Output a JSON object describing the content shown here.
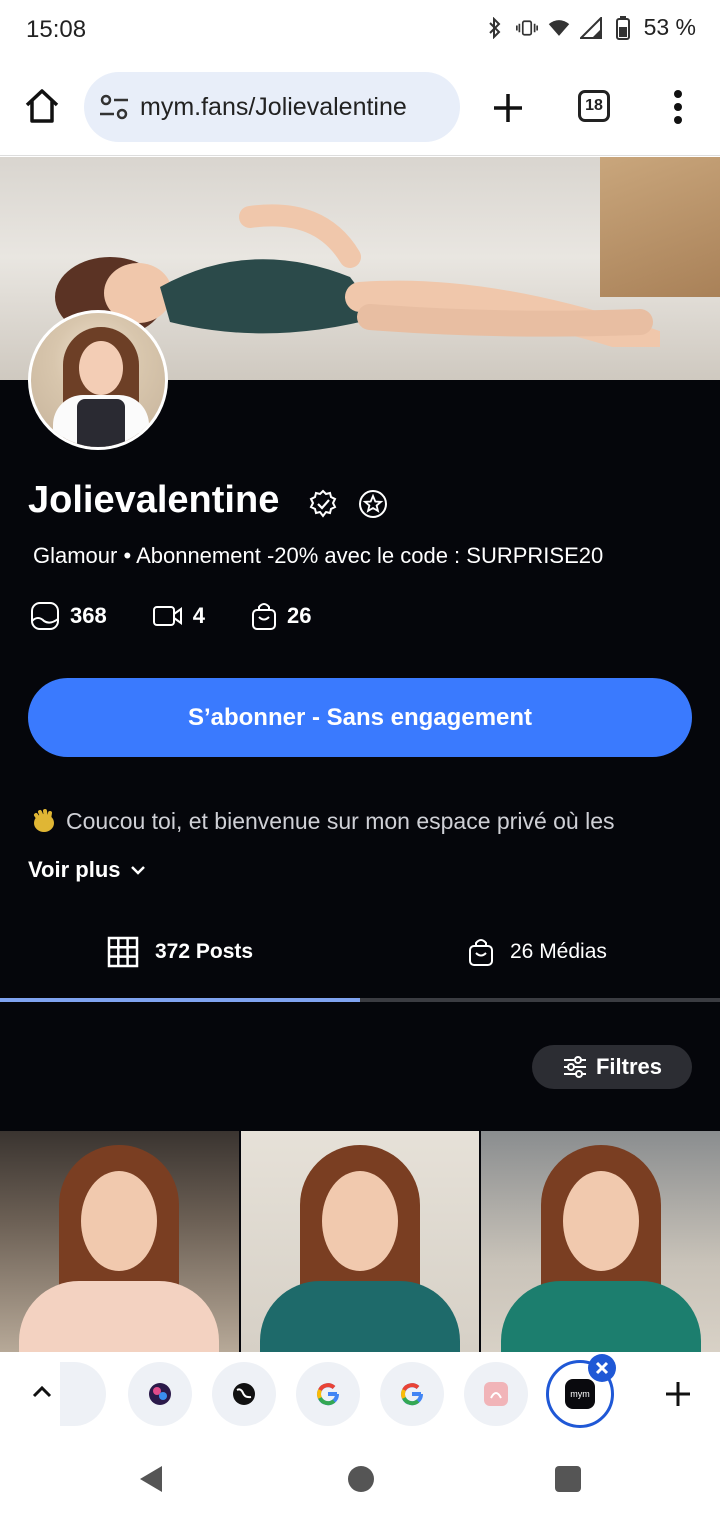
{
  "status_bar": {
    "time": "15:08",
    "battery": "53 %"
  },
  "browser": {
    "url": "mym.fans/Jolievalentine",
    "tab_count": "18"
  },
  "profile": {
    "name": "Jolievalentine",
    "description": "Glamour • Abonnement -20% avec le code : SURPRISE20",
    "stats": [
      {
        "icon": "image-icon",
        "value": "368"
      },
      {
        "icon": "video-icon",
        "value": "4"
      },
      {
        "icon": "shopping-bag-icon",
        "value": "26"
      }
    ],
    "subscribe_label": "S’abonner - Sans engagement",
    "bio": "Coucou toi, et bienvenue sur mon espace privé où les",
    "see_more": "Voir plus"
  },
  "tabs": {
    "posts": "372 Posts",
    "medias": "26 Médias"
  },
  "filter_label": "Filtres",
  "tab_switcher": {
    "active_tab_label": "mym"
  },
  "colors": {
    "accent": "#3a7afe",
    "page_bg": "#05060b",
    "tab_active": "#7fa3f0"
  }
}
